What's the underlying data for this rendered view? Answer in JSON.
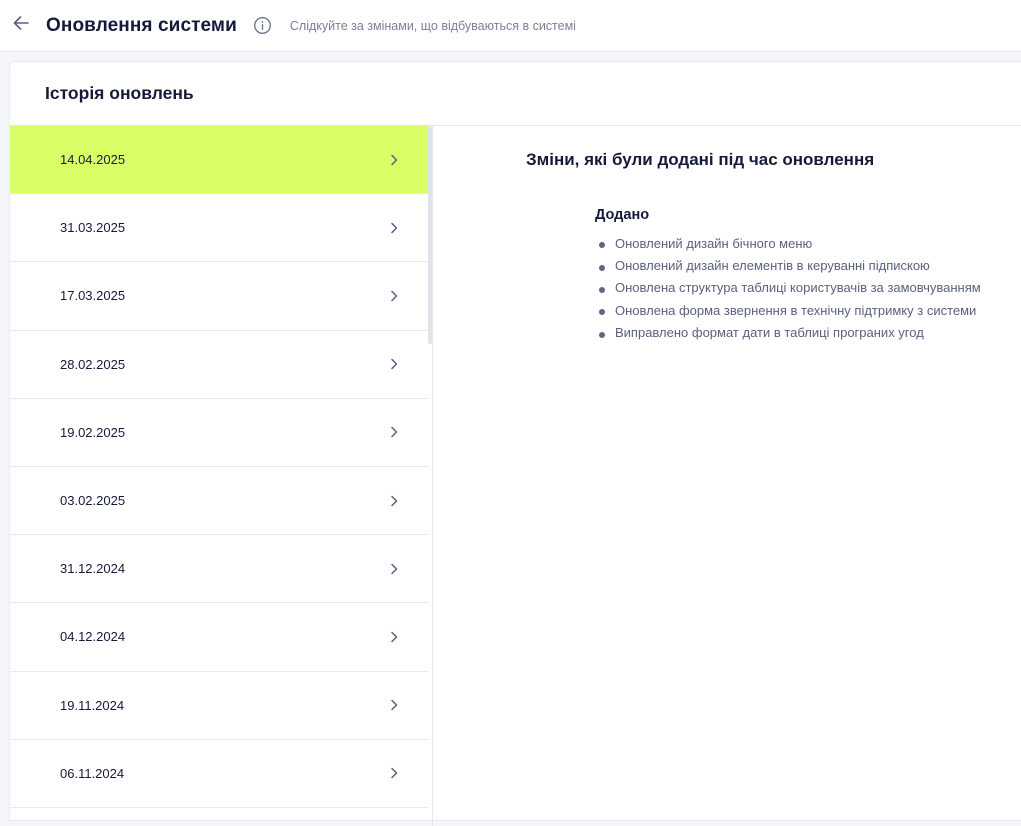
{
  "header": {
    "title": "Оновлення системи",
    "subtitle": "Слідкуйте за змінами, що відбуваються в системі"
  },
  "history": {
    "title": "Історія оновлень",
    "items": [
      {
        "date": "14.04.2025",
        "active": true
      },
      {
        "date": "31.03.2025",
        "active": false
      },
      {
        "date": "17.03.2025",
        "active": false
      },
      {
        "date": "28.02.2025",
        "active": false
      },
      {
        "date": "19.02.2025",
        "active": false
      },
      {
        "date": "03.02.2025",
        "active": false
      },
      {
        "date": "31.12.2024",
        "active": false
      },
      {
        "date": "04.12.2024",
        "active": false
      },
      {
        "date": "19.11.2024",
        "active": false
      },
      {
        "date": "06.11.2024",
        "active": false
      }
    ]
  },
  "details": {
    "title": "Зміни, які були додані під час оновлення",
    "section_title": "Додано",
    "changes": [
      "Оновлений дизайн бічного меню",
      "Оновлений дизайн елементів в керуванні підпискою",
      "Оновлена структура таблиці користувачів за замовчуванням",
      "Оновлена форма звернення в технічну підтримку з системи",
      "Виправлено формат дати в таблиці програних угод"
    ]
  },
  "colors": {
    "accent": "#d9ff66",
    "text": "#151a3a",
    "muted": "#7a8099"
  },
  "icons": {
    "back": "arrow-left-icon",
    "info": "info-circle-icon",
    "row": "chevron-right-icon",
    "bullet": "bullet-dot-icon"
  }
}
